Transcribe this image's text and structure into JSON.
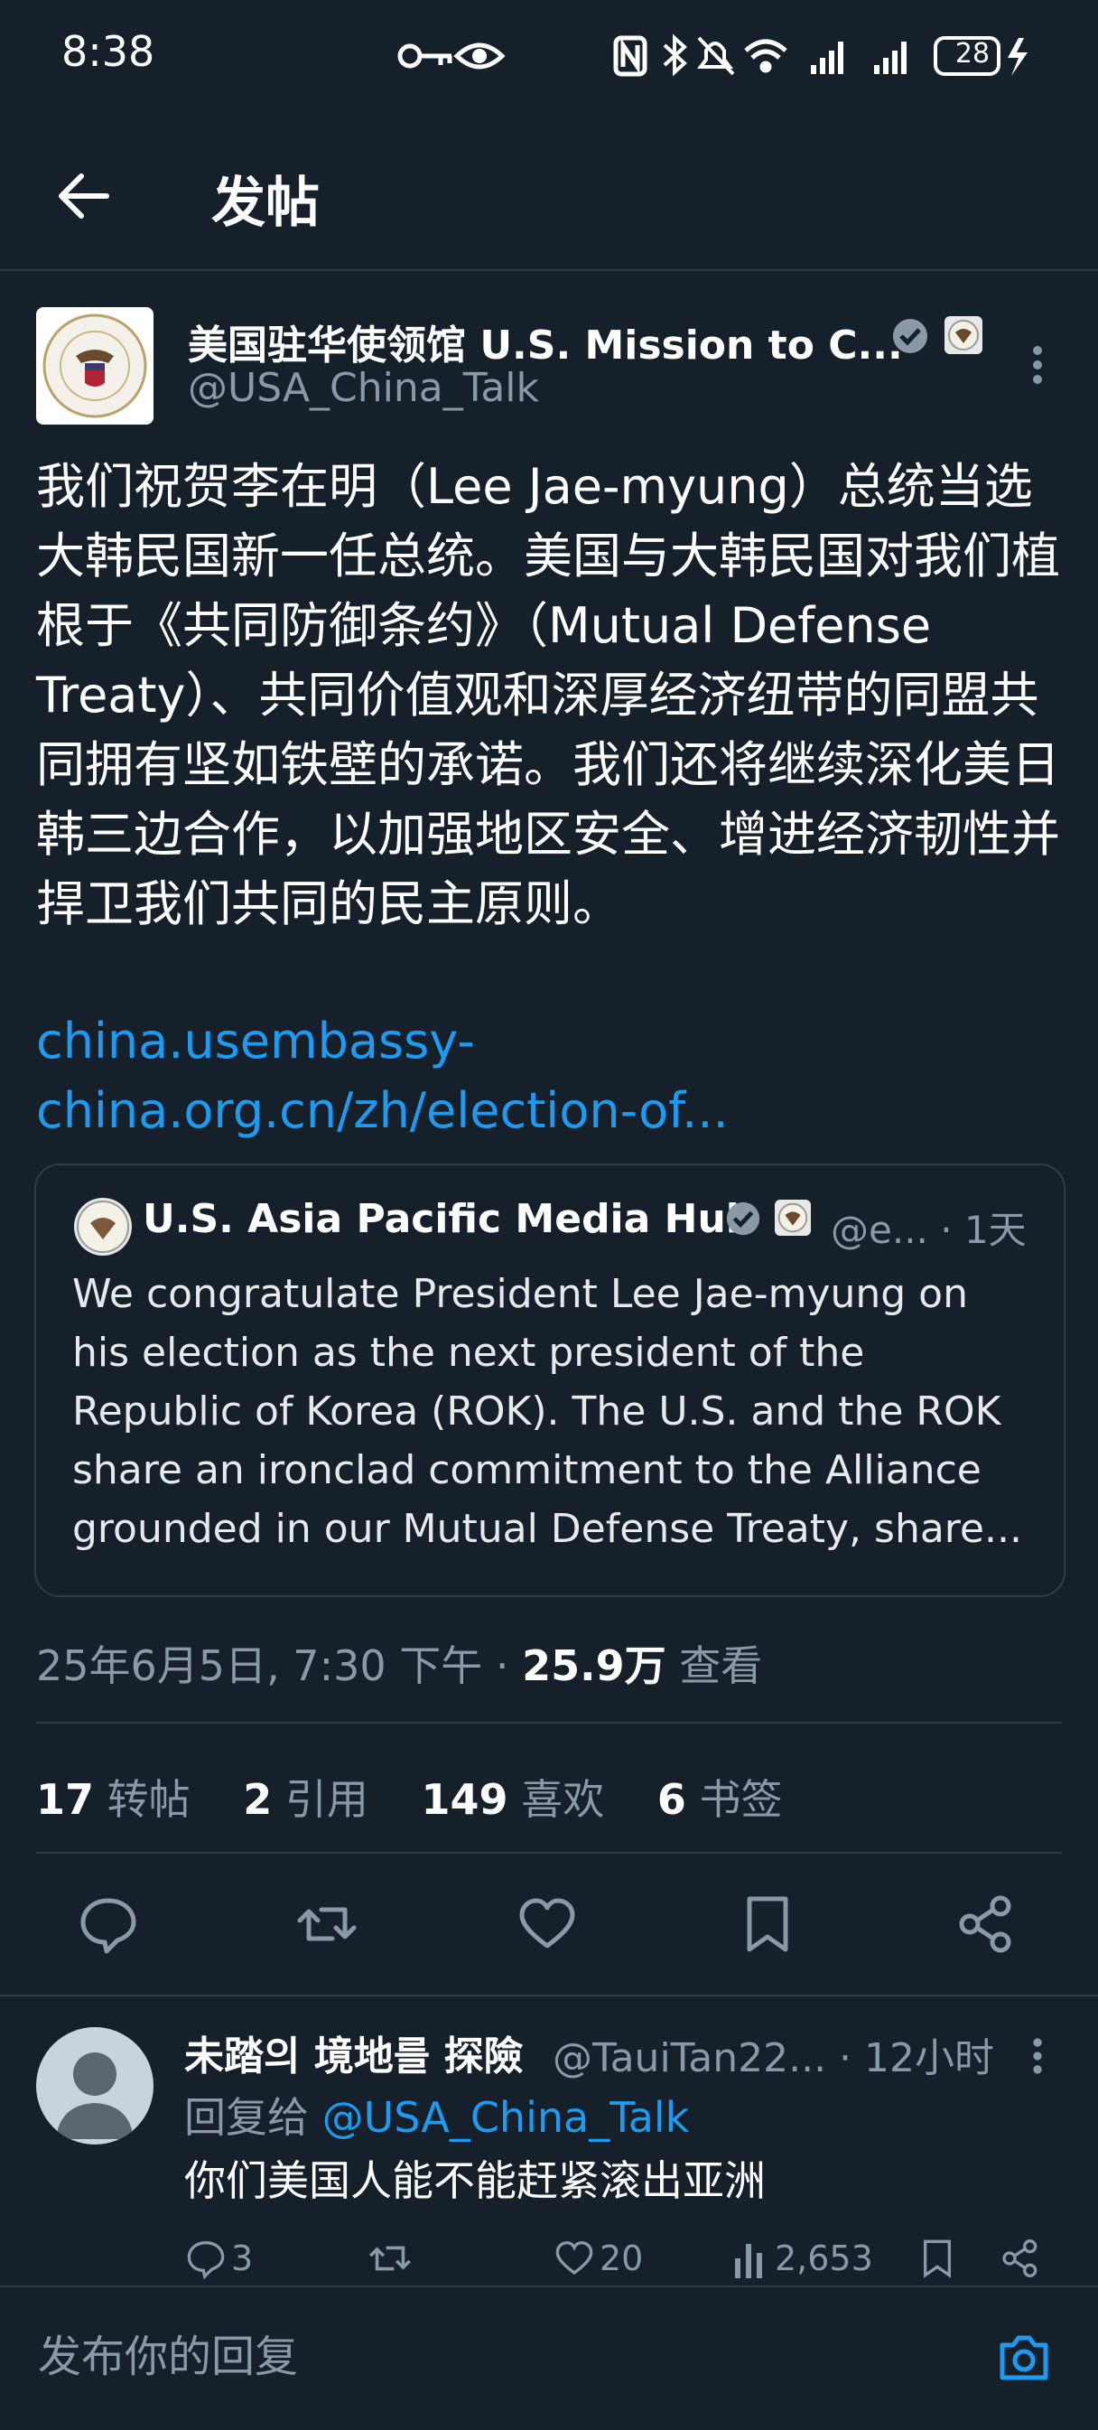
{
  "status_bar": {
    "time": "8:38",
    "battery": "28"
  },
  "header": {
    "title": "发帖"
  },
  "tweet": {
    "author_name": "美国驻华使领馆 U.S. Mission to C...",
    "handle": "@USA_China_Talk",
    "text": "我们祝贺李在明（Lee Jae-myung）总统当选大韩民国新一任总统。美国与大韩民国对我们植根于《共同防御条约》（Mutual Defense Treaty）、共同价值观和深厚经济纽带的同盟共同拥有坚如铁壁的承诺。我们还将继续深化美日韩三边合作，以加强地区安全、增进经济韧性并捍卫我们共同的民主原则。",
    "link": "china.usembassy-china.org.cn/zh/election-of...",
    "timestamp": "25年6月5日, 7:30 下午",
    "views_count": "25.9万",
    "views_label": "查看",
    "stats": {
      "retweets": "17",
      "retweets_label": "转帖",
      "quotes": "2",
      "quotes_label": "引用",
      "likes": "149",
      "likes_label": "喜欢",
      "bookmarks": "6",
      "bookmarks_label": "书签"
    }
  },
  "quote": {
    "name": "U.S. Asia Pacific Media Hub",
    "handle_time": "@e... · 1天",
    "text": "We congratulate President Lee Jae-myung on his election as the next president of the Republic of Korea (ROK). The U.S. and the ROK share an ironclad commitment to the Alliance grounded in our Mutual Defense Treaty, share..."
  },
  "reply": {
    "name": "未踏의 境地를 探險",
    "meta": "@TauiTan22... · 12小时",
    "reply_to_label": "回复给",
    "reply_to_handle": "@USA_China_Talk",
    "text": "你们美国人能不能赶紧滚出亚洲",
    "replies": "3",
    "likes": "20",
    "views": "2,653"
  },
  "compose": {
    "placeholder": "发布你的回复"
  }
}
